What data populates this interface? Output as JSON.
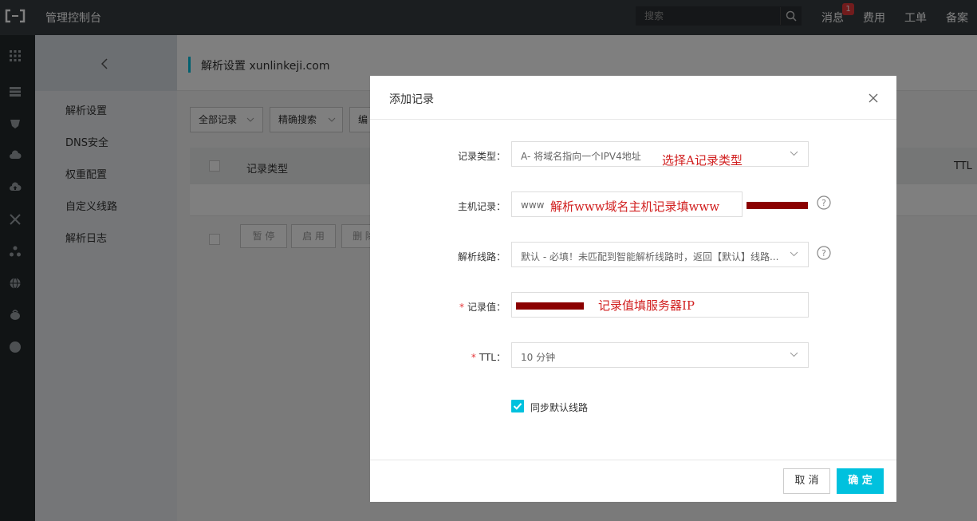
{
  "topbar": {
    "app_title": "管理控制台",
    "search_placeholder": "搜索",
    "nav": {
      "messages": "消息",
      "messages_badge": "1",
      "billing": "费用",
      "tickets": "工单",
      "icp": "备案"
    }
  },
  "sidebar": {
    "items": [
      {
        "label": "解析设置"
      },
      {
        "label": "DNS安全"
      },
      {
        "label": "权重配置"
      },
      {
        "label": "自定义线路"
      },
      {
        "label": "解析日志"
      }
    ]
  },
  "page": {
    "title": "解析设置 xunlinkeji.com",
    "filters": {
      "all_records": "全部记录",
      "precise_search": "精确搜索",
      "third": "编"
    },
    "table": {
      "col_record_type": "记录类型",
      "col_ttl": "TTL"
    },
    "actions": {
      "pause": "暂 停",
      "enable": "启 用",
      "delete": "删 除"
    }
  },
  "dialog": {
    "title": "添加记录",
    "fields": {
      "record_type": {
        "label": "记录类型：",
        "value": "A- 将域名指向一个IPV4地址",
        "annotation": "选择A记录类型"
      },
      "host": {
        "label": "主机记录：",
        "value": "www",
        "annotation": "解析www域名主机记录填www"
      },
      "line": {
        "label": "解析线路：",
        "value": "默认 - 必填！未匹配到智能解析线路时，返回【默认】线路..."
      },
      "record_value": {
        "label": "记录值：",
        "annotation": "记录值填服务器IP"
      },
      "ttl": {
        "label": "TTL：",
        "value": "10 分钟"
      }
    },
    "sync_default_line": {
      "label": "同步默认线路",
      "checked": true
    },
    "buttons": {
      "cancel": "取 消",
      "ok": "确 定"
    }
  },
  "colors": {
    "accent": "#00c1de",
    "annotation": "#d11f1f",
    "redaction": "#8b0000",
    "topbar": "#373d41"
  }
}
